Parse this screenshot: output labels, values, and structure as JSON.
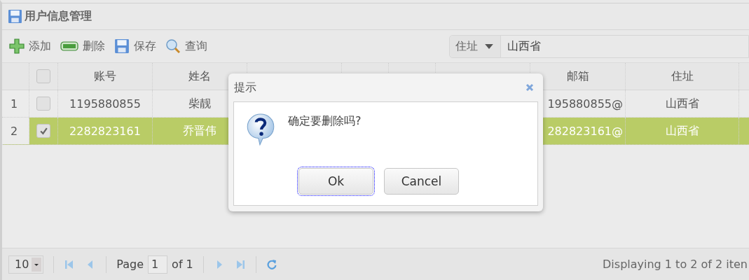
{
  "panel": {
    "title": "用户信息管理"
  },
  "toolbar": [
    {
      "kind": "add",
      "label": "添加"
    },
    {
      "kind": "remove",
      "label": "删除"
    },
    {
      "kind": "save",
      "label": "保存"
    },
    {
      "kind": "search",
      "label": "查询"
    }
  ],
  "search": {
    "field": "住址",
    "value": "山西省"
  },
  "columns": [
    "账号",
    "姓名",
    "邮箱",
    "住址"
  ],
  "header_checked": false,
  "rows": [
    {
      "number": "1",
      "selected": false,
      "checked": false,
      "account": "1195880855",
      "name": "柴靓",
      "email": "195880855@",
      "address": "山西省"
    },
    {
      "number": "2",
      "selected": true,
      "checked": true,
      "account": "2282823161",
      "name": "乔晋伟",
      "email": "282823161@",
      "address": "山西省"
    }
  ],
  "dialog": {
    "title": "提示",
    "message": "确定要删除吗?",
    "buttons": [
      {
        "label": "Ok",
        "focused": true
      },
      {
        "label": "Cancel",
        "focused": false
      }
    ]
  },
  "pager": {
    "page_size": "10",
    "page_label": "Page",
    "page": "1",
    "of_label": "of 1",
    "display": "Displaying 1 to 2 of 2 iten"
  }
}
